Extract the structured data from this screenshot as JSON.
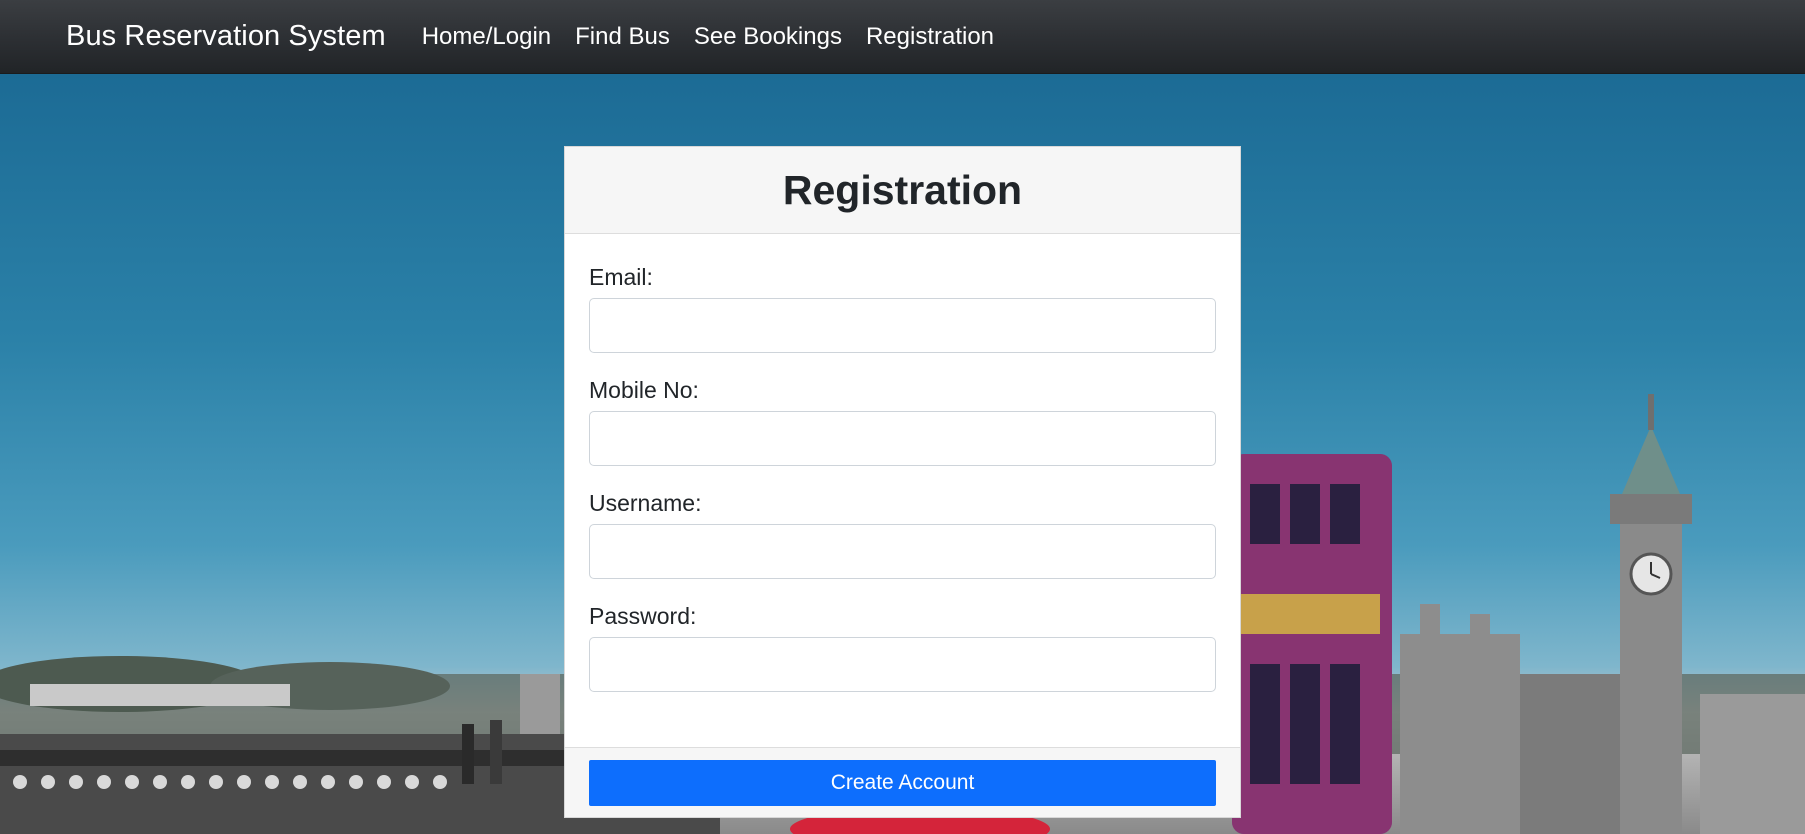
{
  "navbar": {
    "brand": "Bus Reservation System",
    "links": [
      {
        "label": "Home/Login"
      },
      {
        "label": "Find Bus"
      },
      {
        "label": "See Bookings"
      },
      {
        "label": "Registration"
      }
    ]
  },
  "background": {
    "image": "london-street-with-red-double-decker-bus-and-big-ben"
  },
  "form": {
    "title": "Registration",
    "fields": [
      {
        "label": "Email:",
        "value": "",
        "placeholder": ""
      },
      {
        "label": "Mobile No:",
        "value": "",
        "placeholder": ""
      },
      {
        "label": "Username:",
        "value": "",
        "placeholder": ""
      },
      {
        "label": "Password:",
        "value": "",
        "placeholder": ""
      }
    ],
    "submit_label": "Create Account"
  },
  "colors": {
    "navbar": "#2c2f33",
    "primary_button": "#0d6efd",
    "sky": "#2b81a8"
  }
}
